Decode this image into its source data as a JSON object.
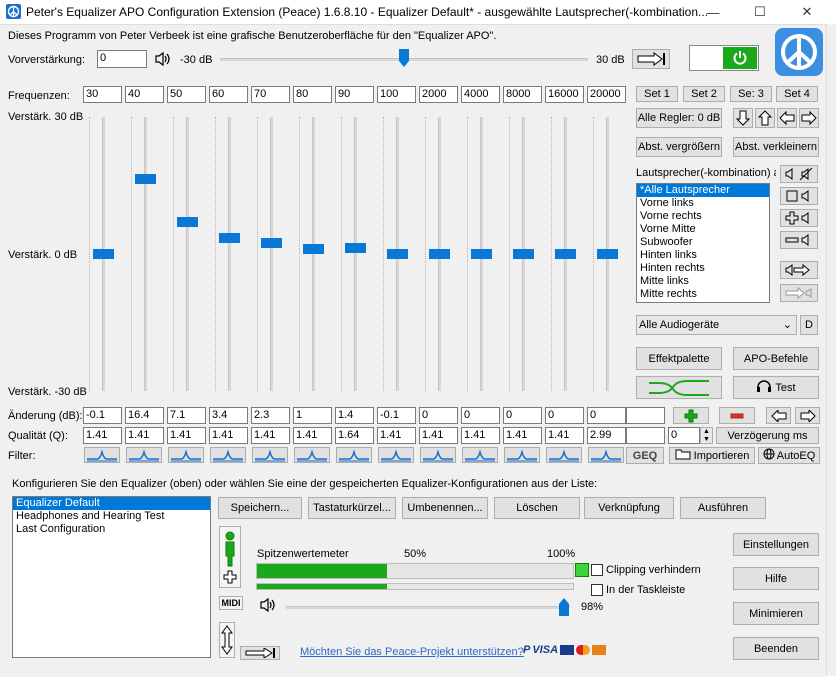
{
  "window": {
    "title": "Peter's Equalizer APO Configuration Extension (Peace) 1.6.8.10 - Equalizer Default* - ausgewählte Lautsprecher(-kombination...",
    "minimize": "—",
    "maximize": "☐",
    "close": "✕"
  },
  "intro": "Dieses Programm von Peter Verbeek ist eine grafische Benutzeroberfläche für den \"Equalizer APO\".",
  "preamp": {
    "label": "Vorverstärkung:",
    "value": "0",
    "min_label": "-30 dB",
    "max_label": "30 dB",
    "level": 0.5
  },
  "freq_label": "Frequenzen:",
  "frequencies": [
    "30",
    "40",
    "50",
    "60",
    "70",
    "80",
    "90",
    "100",
    "2000",
    "4000",
    "8000",
    "16000",
    "20000"
  ],
  "sets": [
    "Set 1",
    "Set 2",
    "Se: 3",
    "Set 4"
  ],
  "gain_labels": {
    "top": "Verstärk. 30 dB",
    "mid": "Verstärk. 0 dB",
    "bottom": "Verstärk. -30 dB"
  },
  "change_label": "Änderung (dB):",
  "gains": [
    "-0.1",
    "16.4",
    "7.1",
    "3.4",
    "2.3",
    "1",
    "1.4",
    "-0.1",
    "0",
    "0",
    "0",
    "0",
    "0"
  ],
  "quality_label": "Qualität (Q):",
  "qualities": [
    "1.41",
    "1.41",
    "1.41",
    "1.41",
    "1.41",
    "1.41",
    "1.64",
    "1.41",
    "1.41",
    "1.41",
    "1.41",
    "1.41",
    "2.99"
  ],
  "filter_label": "Filter:",
  "right_panel": {
    "all_reset": "Alle Regler: 0 dB",
    "expand": "Abst. vergrößern",
    "shrink": "Abst. verkleinern",
    "speaker_label": "Lautsprecher(-kombination) au",
    "speakers": [
      "*Alle Lautsprecher",
      "Vorne links",
      "Vorne rechts",
      "Vorne Mitte",
      "Subwoofer",
      "Hinten links",
      "Hinten rechts",
      "Mitte links",
      "Mitte rechts"
    ],
    "device": "Alle Audiogeräte",
    "d_button": "D",
    "effects": "Effektpalette",
    "apo": "APO-Befehle",
    "test": "Test",
    "delay_value": "0",
    "delay": "Verzögerung ms",
    "geq": "GEQ",
    "import": "Importieren",
    "autoeq": "AutoEQ"
  },
  "config": {
    "label": "Konfigurieren Sie den Equalizer (oben) oder wählen Sie eine der gespeicherten Equalizer-Konfigurationen aus der Liste:",
    "items": [
      "Equalizer Default",
      "Headphones and Hearing Test",
      "Last Configuration"
    ],
    "save": "Speichern...",
    "hotkeys": "Tastaturkürzel...",
    "rename": "Umbenennen...",
    "delete": "Löschen",
    "shortcut": "Verknüpfung",
    "run": "Ausführen"
  },
  "meter": {
    "label": "Spitzenwertemeter",
    "p50": "50%",
    "p100": "100%",
    "clip": "Clipping verhindern",
    "taskbar": "In der Taskleiste",
    "volume_pct": "98%",
    "volume_level": 0.98,
    "bar1_level": 0.41,
    "bar2_level": 0.41,
    "midi": "MIDI"
  },
  "side_buttons": {
    "settings": "Einstellungen",
    "help": "Hilfe",
    "minimize": "Minimieren",
    "quit": "Beenden"
  },
  "support_link": "Möchten Sie das Peace-Projekt unterstützen?",
  "payment": {
    "paypal": "PayPal",
    "visa": "VISA"
  },
  "colors": {
    "accent": "#0a78d7",
    "power_green": "#1ba81b",
    "meter_green": "#1ba81b",
    "link": "#2a6ac8"
  }
}
